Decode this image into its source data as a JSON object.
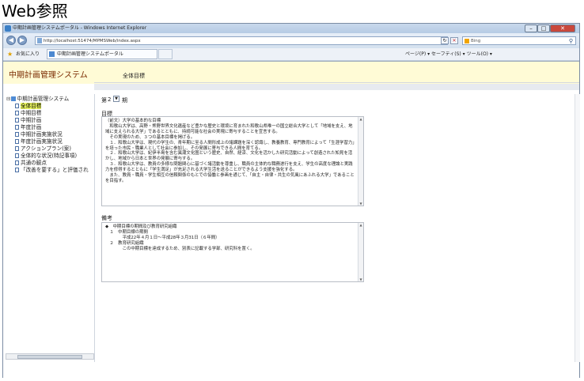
{
  "heading": "Web参照",
  "window": {
    "title": "中期計画管理システムポータル - Windows Internet Explorer",
    "min_label": "–",
    "max_label": "□",
    "close_label": "✕"
  },
  "address": {
    "url": "http://localhost:51474/MPMSWeb/index.aspx",
    "search_placeholder": "Bing",
    "back_label": "◀",
    "forward_label": "▶",
    "refresh_label": "↻",
    "stop_label": "✕"
  },
  "favorites": {
    "label": "お気に入り",
    "tab_title": "中期計画管理システムポータル",
    "command_bar": "ページ(P) ▾  セーフティ(S) ▾  ツール(O) ▾"
  },
  "app": {
    "title": "中期計画管理システム",
    "subtitle": "全体目標"
  },
  "tree": {
    "root": "中期計画管理システム",
    "items": [
      "全体目標",
      "中期目標",
      "中期計画",
      "年度計画",
      "中期計画実施状況",
      "年度計画実施状況",
      "アクションプラン(案)",
      "全体的な状況(特記事項)",
      "共通の観点",
      "「改善を要する」と評価され"
    ],
    "selected_index": 0
  },
  "period": {
    "prefix": "第",
    "value": "2",
    "suffix": "期"
  },
  "goal": {
    "label": "目標",
    "text": "（前文）大学の基本的な目標\n　和歌山大学は、高野・熊野世界文化遺産など豊かな歴史と環境に育まれた和歌山県唯一の国立総合大学として「地域を支え、地域に支えられる大学」であるとともに、持続可能な社会の実現に寄与することを宣言する。\n　その実現のため、３つの基本目標を掲げる。\n　１．和歌山大学は、現代の学生の、青年期に至る人間形成上の諸課題を深く認識し、教養教育、専門教育によって「生涯学習力」を培った市民・職業人として社会に参加し、その発展に寄与できる人間を育てる。\n　２．和歌山大学は、紀伊半島を含む異潮文化圏という歴史、自然、経済、文化を活かした研究活動によって創造された知見を活かし、地域から日本と世界の発展に寄与する。\n　３．和歌山大学は、教員の多様な問題関心に基づく諸活動を尊重し、職員の主体的な職務遂行を支え、学生の高度な理論と実践力を修得するとともに「学生満足」が充足される大学生活を送ることができるよう支援を強化する。\n　また、教員・職員・学生相互の信頼関係のもとでの協働と参画を通じて、「自主・自律・共生の気風にあふれる大学」であることを目指す。"
  },
  "remarks": {
    "label": "備考",
    "text": "◆　中期目標の期間及び教育研究組織\n　１　中期目標の期間\n　　　　平成22年４月１日～平成28年３月31日（６年間）\n　２　教育研究組織\n　　　　この中期目標を達成するため、別表に記載する学部、研究科を置く。"
  }
}
